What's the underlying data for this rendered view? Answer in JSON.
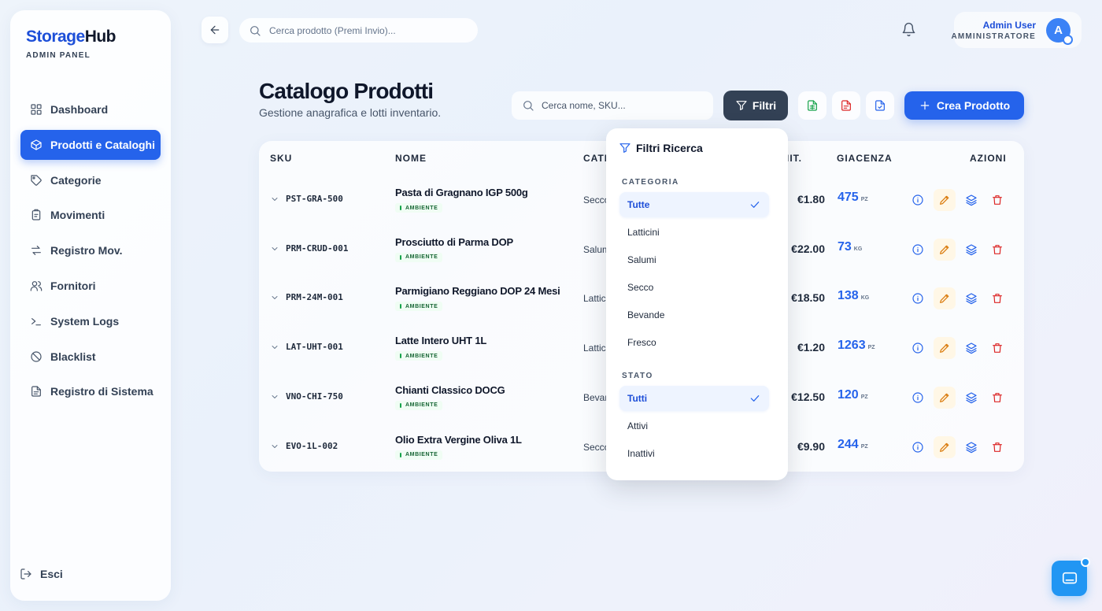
{
  "brand": {
    "name_a": "Storage",
    "name_b": "Hub",
    "subtitle": "ADMIN PANEL"
  },
  "sidebar": {
    "items": [
      {
        "label": "Dashboard",
        "icon": "grid-icon"
      },
      {
        "label": "Prodotti e Cataloghi",
        "icon": "package-icon",
        "active": true
      },
      {
        "label": "Categorie",
        "icon": "tag-icon"
      },
      {
        "label": "Movimenti",
        "icon": "clipboard-icon"
      },
      {
        "label": "Registro Mov.",
        "icon": "arrows-icon"
      },
      {
        "label": "Fornitori",
        "icon": "users-icon"
      },
      {
        "label": "System Logs",
        "icon": "terminal-icon"
      },
      {
        "label": "Blacklist",
        "icon": "ban-icon"
      },
      {
        "label": "Registro di Sistema",
        "icon": "file-icon"
      }
    ],
    "logout_label": "Esci"
  },
  "topbar": {
    "search_placeholder": "Cerca prodotto (Premi Invio)...",
    "user_name": "Admin User",
    "user_role": "AMMINISTRATORE",
    "avatar_letter": "A"
  },
  "header": {
    "title": "Catalogo Prodotti",
    "subtitle": "Gestione anagrafica e lotti inventario.",
    "search_placeholder": "Cerca nome, SKU...",
    "filter_label": "Filtri",
    "create_label": "Crea Prodotto"
  },
  "table": {
    "columns": {
      "sku": "SKU",
      "name": "NOME",
      "category": "CATEGORIA",
      "price": "PREZZO UNIT.",
      "stock": "GIACENZA",
      "actions": "AZIONI"
    },
    "rows": [
      {
        "sku": "PST-GRA-500",
        "name": "Pasta di Gragnano IGP 500g",
        "badge": "AMBIENTE",
        "category": "Secco",
        "price": "€1.80",
        "stock": "475",
        "unit": "PZ"
      },
      {
        "sku": "PRM-CRUD-001",
        "name": "Prosciutto di Parma DOP",
        "badge": "AMBIENTE",
        "category": "Salumi",
        "price": "€22.00",
        "stock": "73",
        "unit": "KG"
      },
      {
        "sku": "PRM-24M-001",
        "name": "Parmigiano Reggiano DOP 24 Mesi",
        "badge": "AMBIENTE",
        "category": "Latticini",
        "price": "€18.50",
        "stock": "138",
        "unit": "KG"
      },
      {
        "sku": "LAT-UHT-001",
        "name": "Latte Intero UHT 1L",
        "badge": "AMBIENTE",
        "category": "Latticini",
        "price": "€1.20",
        "stock": "1263",
        "unit": "PZ"
      },
      {
        "sku": "VNO-CHI-750",
        "name": "Chianti Classico DOCG",
        "badge": "AMBIENTE",
        "category": "Bevande",
        "price": "€12.50",
        "stock": "120",
        "unit": "PZ"
      },
      {
        "sku": "EVO-1L-002",
        "name": "Olio Extra Vergine Oliva 1L",
        "badge": "AMBIENTE",
        "category": "Secco",
        "price": "€9.90",
        "stock": "244",
        "unit": "PZ"
      }
    ]
  },
  "filters": {
    "title": "Filtri Ricerca",
    "category_label": "CATEGORIA",
    "category_options": [
      "Tutte",
      "Latticini",
      "Salumi",
      "Secco",
      "Bevande",
      "Fresco"
    ],
    "category_selected": "Tutte",
    "status_label": "STATO",
    "status_options": [
      "Tutti",
      "Attivi",
      "Inattivi"
    ],
    "status_selected": "Tutti"
  },
  "colors": {
    "accent": "#2563eb",
    "stock": "#2563eb",
    "edit": "#d97706",
    "delete": "#dc2626",
    "export_xls": "#16a34a",
    "export_pdf": "#dc2626",
    "export_doc": "#2563eb"
  }
}
